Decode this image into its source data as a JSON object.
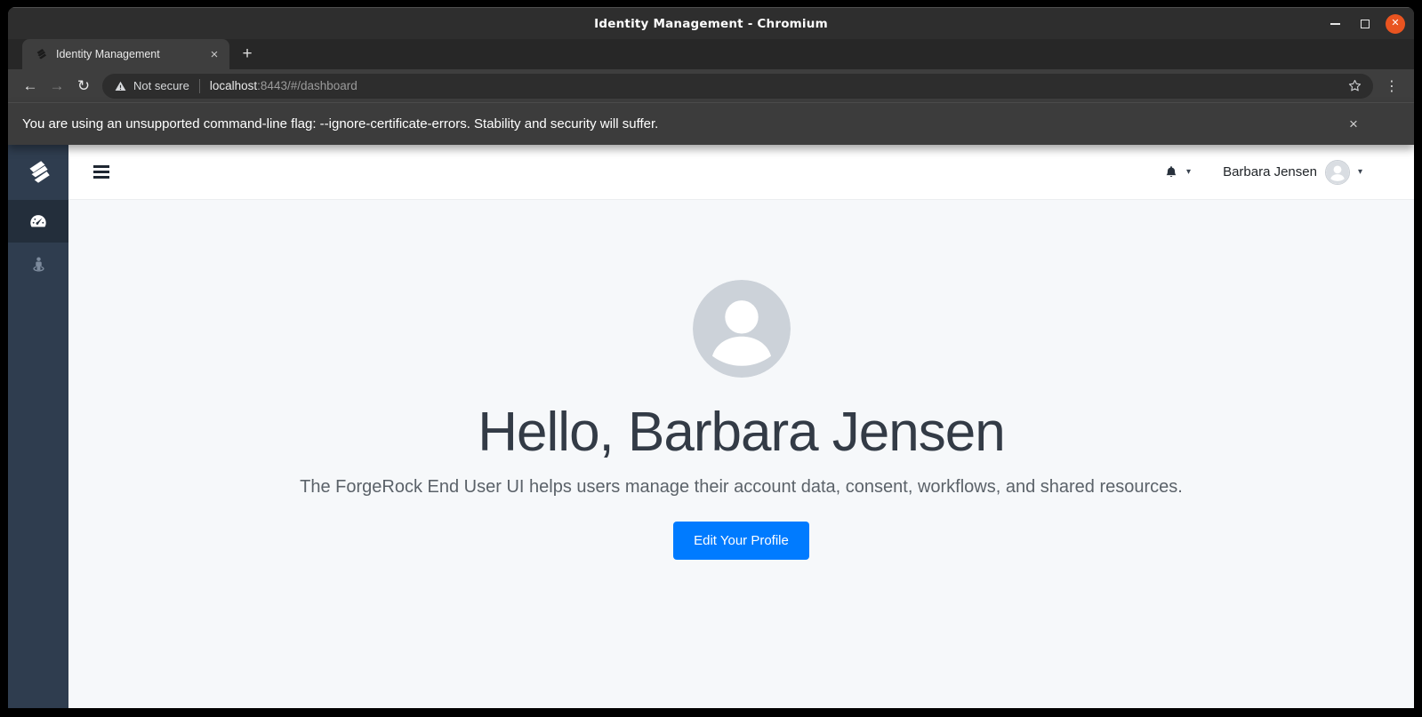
{
  "titlebar": {
    "title": "Identity Management - Chromium",
    "close_glyph": "✕"
  },
  "tabbar": {
    "tab_title": "Identity Management",
    "tab_close_glyph": "×",
    "new_tab_glyph": "+"
  },
  "toolbar": {
    "back_glyph": "←",
    "forward_glyph": "→",
    "reload_glyph": "↻",
    "security_label": "Not secure",
    "url_host": "localhost",
    "url_rest": ":8443/#/dashboard",
    "menu_glyph": "⋮"
  },
  "warning_bar": {
    "message": "You are using an unsupported command-line flag: --ignore-certificate-errors. Stability and security will suffer.",
    "close_glyph": "×"
  },
  "navbar": {
    "user_name": "Barbara Jensen",
    "bell_caret_glyph": "▾",
    "user_caret_glyph": "▾"
  },
  "sidebar": {
    "logo_icon": "forgerock-logo",
    "items": [
      {
        "id": "dashboard",
        "icon": "tachometer-icon",
        "active": true
      },
      {
        "id": "profile",
        "icon": "street-view-icon",
        "active": false
      }
    ]
  },
  "main": {
    "greeting": "Hello, Barbara Jensen",
    "description": "The ForgeRock End User UI helps users manage their account data, consent, workflows, and shared resources.",
    "edit_profile_label": "Edit Your Profile"
  },
  "colors": {
    "primary": "#007bff",
    "sidebar": "#2f3d4f",
    "sidebar_active": "#232e3b",
    "main_bg": "#f6f8fa",
    "titlebar_bg": "#2e2e2e",
    "toolbar_bg": "#3e3e3e",
    "warning_bg": "#3c3c3c",
    "close_button": "#e95420",
    "avatar_gray": "#ccd2d9"
  }
}
